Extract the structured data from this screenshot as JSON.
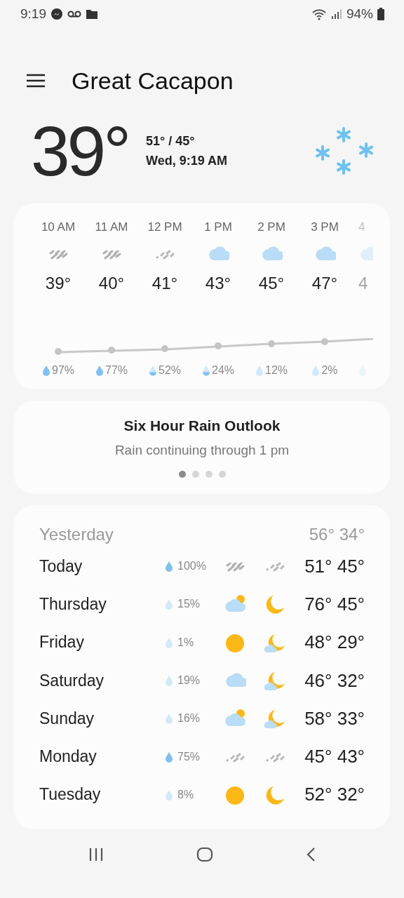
{
  "status_bar": {
    "time": "9:19",
    "battery": "94%"
  },
  "header": {
    "location": "Great Cacapon"
  },
  "current": {
    "temperature": "39°",
    "high_low": "51° / 45°",
    "updated": "Wed, 9:19 AM",
    "condition": {
      "kind": "snow"
    }
  },
  "hourly": [
    {
      "time": "10 AM",
      "icon": {
        "kind": "rain-heavy"
      },
      "temp": "39°",
      "precip": {
        "kind": "full",
        "text": "97%"
      }
    },
    {
      "time": "11 AM",
      "icon": {
        "kind": "rain-heavy"
      },
      "temp": "40°",
      "precip": {
        "kind": "full",
        "text": "77%"
      }
    },
    {
      "time": "12 PM",
      "icon": {
        "kind": "rain-light"
      },
      "temp": "41°",
      "precip": {
        "kind": "half",
        "text": "52%"
      }
    },
    {
      "time": "1 PM",
      "icon": {
        "kind": "cloudy"
      },
      "temp": "43°",
      "precip": {
        "kind": "half",
        "text": "24%"
      }
    },
    {
      "time": "2 PM",
      "icon": {
        "kind": "cloudy"
      },
      "temp": "45°",
      "precip": {
        "kind": "light",
        "text": "12%"
      }
    },
    {
      "time": "3 PM",
      "icon": {
        "kind": "cloudy"
      },
      "temp": "47°",
      "precip": {
        "kind": "light",
        "text": "2%"
      }
    },
    {
      "time": "4",
      "icon": {
        "kind": "cloudy"
      },
      "temp": "4",
      "precip": {
        "kind": "light"
      }
    }
  ],
  "outlook": {
    "title": "Six Hour Rain Outlook",
    "text": "Rain continuing through 1 pm",
    "page_dots": [
      {
        "selected": true
      },
      {
        "selected": false
      },
      {
        "selected": false
      },
      {
        "selected": false
      }
    ]
  },
  "daily": {
    "yesterday": {
      "label": "Yesterday",
      "high": "56°",
      "low": "34°"
    },
    "days": [
      {
        "day": "Today",
        "precip": {
          "kind": "full",
          "text": "100%"
        },
        "day_icon": {
          "kind": "rain-heavy"
        },
        "night_icon": {
          "kind": "rain-light"
        },
        "high": "51°",
        "low": "45°"
      },
      {
        "day": "Thursday",
        "precip": {
          "kind": "light",
          "text": "15%"
        },
        "day_icon": {
          "kind": "partly-cloudy-day"
        },
        "night_icon": {
          "kind": "moon"
        },
        "high": "76°",
        "low": "45°"
      },
      {
        "day": "Friday",
        "precip": {
          "kind": "light",
          "text": "1%"
        },
        "day_icon": {
          "kind": "sunny"
        },
        "night_icon": {
          "kind": "partly-cloudy-night"
        },
        "high": "48°",
        "low": "29°"
      },
      {
        "day": "Saturday",
        "precip": {
          "kind": "light",
          "text": "19%"
        },
        "day_icon": {
          "kind": "cloudy"
        },
        "night_icon": {
          "kind": "partly-cloudy-night"
        },
        "high": "46°",
        "low": "32°"
      },
      {
        "day": "Sunday",
        "precip": {
          "kind": "light",
          "text": "16%"
        },
        "day_icon": {
          "kind": "partly-cloudy-day"
        },
        "night_icon": {
          "kind": "partly-cloudy-night"
        },
        "high": "58°",
        "low": "33°"
      },
      {
        "day": "Monday",
        "precip": {
          "kind": "full",
          "text": "75%"
        },
        "day_icon": {
          "kind": "rain-light"
        },
        "night_icon": {
          "kind": "rain-light"
        },
        "high": "45°",
        "low": "43°"
      },
      {
        "day": "Tuesday",
        "precip": {
          "kind": "light",
          "text": "8%"
        },
        "day_icon": {
          "kind": "sunny"
        },
        "night_icon": {
          "kind": "moon"
        },
        "high": "52°",
        "low": "32°"
      }
    ]
  }
}
